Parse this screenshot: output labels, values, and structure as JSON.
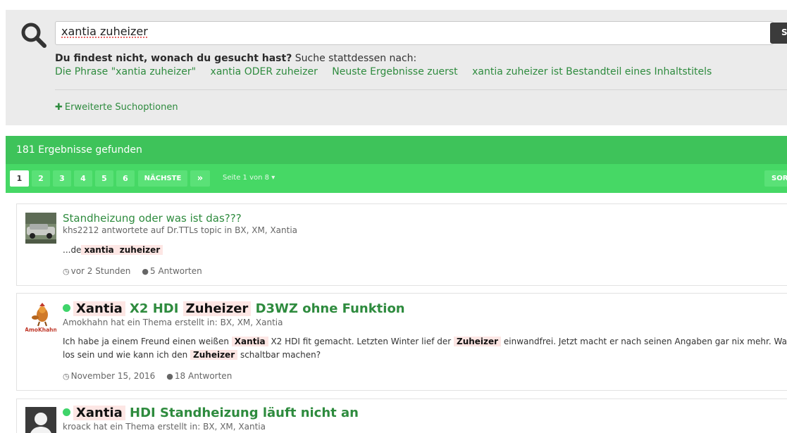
{
  "search": {
    "query": "xantia zuheizer",
    "button_label": "S",
    "hint_bold": "Du findest nicht, wonach du gesucht hast?",
    "hint_rest": " Suche stattdessen nach:",
    "suggestions": [
      "Die Phrase \"xantia zuheizer\"",
      "xantia ODER zuheizer",
      "Neuste Ergebnisse zuerst",
      "xantia zuheizer ist Bestandteil eines Inhaltstitels"
    ],
    "advanced_label": "Erweiterte Suchoptionen"
  },
  "results": {
    "count_label": "181 Ergebnisse gefunden",
    "pages": [
      "1",
      "2",
      "3",
      "4",
      "5",
      "6"
    ],
    "next_label": "NÄCHSTE",
    "last_label": "»",
    "page_info": "Seite 1 von 8",
    "sort_label": "SOR"
  },
  "items": [
    {
      "title": "Standheizung oder was ist das???",
      "meta": "khs2212 antwortete auf Dr.TTLs topic in BX, XM, Xantia",
      "snippet_prefix": "...de",
      "snippet_hl1": "xantia",
      "snippet_hl2": "zuheizer",
      "time": "vor 2 Stunden",
      "replies": "5 Antworten"
    },
    {
      "title_hl1": "Xantia",
      "title_mid": " X2 HDI ",
      "title_hl2": "Zuheizer",
      "title_end": " D3WZ ohne Funktion",
      "meta": "Amokhahn hat ein Thema erstellt in: BX, XM, Xantia",
      "avatar_text": "AmoKhahn",
      "s1": "Ich habe ja einem Freund einen weißen",
      "s1_hl": "Xantia",
      "s2": " X2 HDI fit gemacht. Letzten Winter lief der",
      "s2_hl": "Zuheizer",
      "s3": " einwandfrei. Jetzt macht er nach seinen Angaben gar nix mehr. Was",
      "l2a": "los sein und wie kann ich den",
      "l2_hl": "Zuheizer",
      "l2b": " schaltbar machen?",
      "time": "November 15, 2016",
      "replies": "18 Antworten"
    },
    {
      "title_hl1": "Xantia",
      "title_end": " HDI Standheizung läuft nicht an",
      "meta": "kroack hat ein Thema erstellt in: BX, XM, Xantia"
    }
  ],
  "icons": {
    "search": "magnifier-icon",
    "plus": "plus-icon",
    "clock": "clock-icon",
    "comment": "comment-icon",
    "caret": "caret-down-icon"
  },
  "colors": {
    "accent_green": "#3ec35a",
    "pager_green": "#46d865",
    "link_green": "#2e8b3e",
    "highlight": "#fde6e4"
  }
}
